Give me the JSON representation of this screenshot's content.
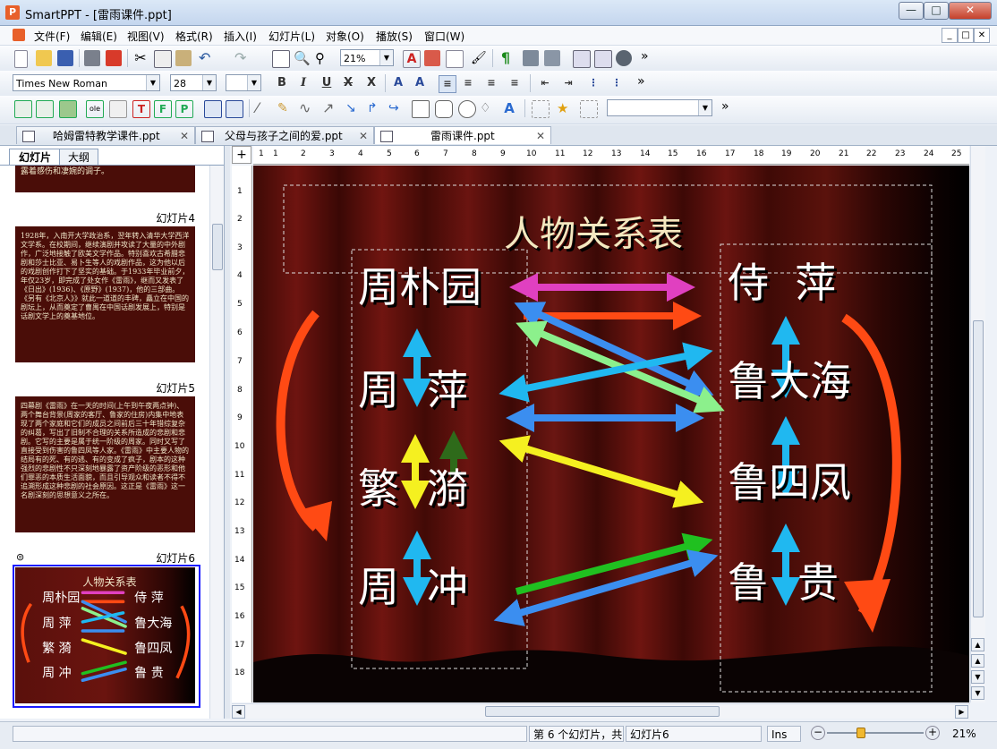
{
  "window": {
    "title": "SmartPPT - [雷雨课件.ppt]",
    "app_icon": "P"
  },
  "menu": [
    "文件(F)",
    "编辑(E)",
    "视图(V)",
    "格式(R)",
    "插入(I)",
    "幻灯片(L)",
    "对象(O)",
    "播放(S)",
    "窗口(W)"
  ],
  "toolbar": {
    "zoom": "21%",
    "font": "Times New Roman",
    "size": "28",
    "more": "»"
  },
  "tabs": [
    {
      "label": "哈姆雷特教学课件.ppt"
    },
    {
      "label": "父母与孩子之间的爱.ppt"
    },
    {
      "label": "雷雨课件.ppt"
    }
  ],
  "sidepanel": {
    "tab_slides": "幻灯片",
    "tab_outline": "大纲",
    "thumb3_tail": "露着感伤和凄婉的调子。",
    "label4": "幻灯片4",
    "thumb4_text": "1928年，入南开大学政治系，翌年转入清华大学西洋文学系。在校期间，继续演剧并攻读了大量的中外剧作，广泛地接触了欧美文学作品。特别喜欢古希腊悲剧和莎士比亚、易卜生等人的戏剧作品，这为他以后的戏剧创作打下了坚实的基础。于1933年毕业前夕，年仅23岁，即完成了处女作《雷雨》，继而又发表了《日出》(1936)、《原野》(1937)，他的三部曲。《另有《北京人》》就此一道道的丰碑，矗立在中国的剧坛上，从而奠定了曹禺在中国话剧发展上，特别是话剧文学上的奠基地位。",
    "label5": "幻灯片5",
    "thumb5_text": "四幕剧《雷雨》在一天的时间(上午到午夜两点钟)、两个舞台背景(周家的客厅、鲁家的住房)内集中地表现了两个家庭和它们的成员之间前后三十年错综复杂的纠葛，写出了旧制不合理的关系所造成的悲剧和悲剧。它写的主要是属于统一阶级的周家。同时又写了直接受到伤害的鲁四凤等人家。《雷雨》中主要人物的结局有的死、有的逃、有的变成了疯子，剧本的这种强烈的悲剧性不只深刻地暴露了资产阶级的恶形和他们罪恶的本质生活面貌，而且引导观众和读者不得不追溯形成这种悲剧的社会原因。这正是《雷雨》这一名剧深刻的思想意义之所在。",
    "label6": "幻灯片6"
  },
  "slide": {
    "title": "人物关系表",
    "left": [
      "周朴园",
      "周",
      "萍",
      "繁",
      "漪",
      "周",
      "冲"
    ],
    "right": [
      "侍  萍",
      "鲁大海",
      "鲁四凤",
      "鲁",
      "贵"
    ]
  },
  "ruler_h": [
    "1",
    "1",
    "2",
    "3",
    "4",
    "5",
    "6",
    "7",
    "8",
    "9",
    "10",
    "11",
    "12",
    "13",
    "14",
    "15",
    "16",
    "17",
    "18",
    "19",
    "20",
    "21",
    "22",
    "23",
    "24",
    "25"
  ],
  "ruler_v": [
    "1",
    "2",
    "3",
    "4",
    "5",
    "6",
    "7",
    "8",
    "9",
    "10",
    "11",
    "12",
    "13",
    "14",
    "15",
    "16",
    "17",
    "18"
  ],
  "status": {
    "slide_info": "第 6 个幻灯片，共",
    "slide_name": "幻灯片6",
    "ins": "Ins",
    "zoom": "21%"
  },
  "colors": {
    "magenta": "#e040c0",
    "orange_red": "#ff4a14",
    "blue": "#3b8ef0",
    "light_green": "#8cf08c",
    "cyan": "#20b8f0",
    "yellow": "#f5f020",
    "green": "#20c020",
    "dark_green": "#2e6a1a"
  }
}
